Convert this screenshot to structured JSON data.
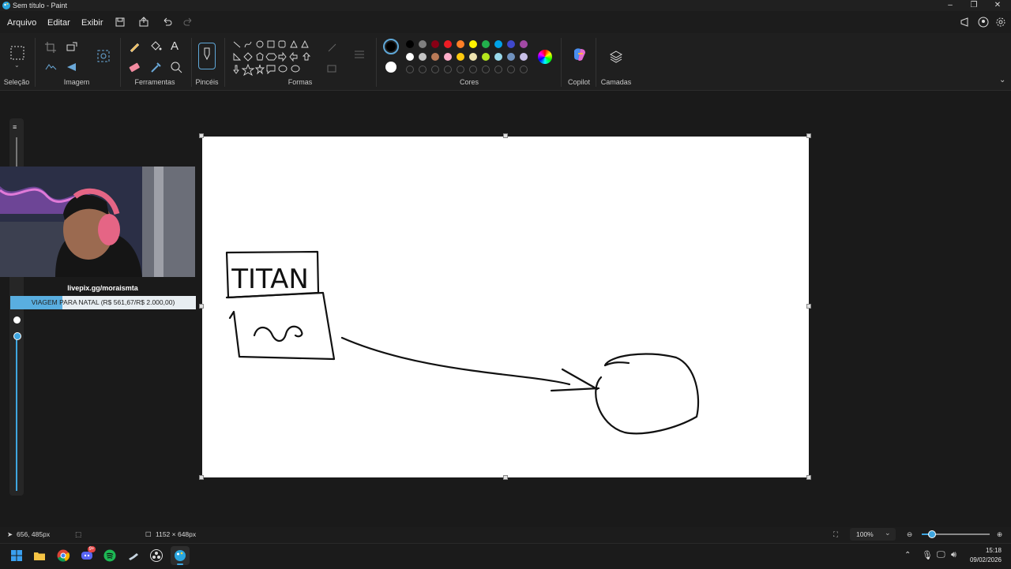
{
  "window": {
    "title": "Sem título - Paint"
  },
  "menu": {
    "items": [
      "Arquivo",
      "Editar",
      "Exibir"
    ]
  },
  "ribbon": {
    "groups": [
      "Seleção",
      "Imagem",
      "Ferramentas",
      "Pincéis",
      "Formas",
      "Cores",
      "Copilot",
      "Camadas"
    ]
  },
  "colors": {
    "primary": "#000000",
    "secondary": "#ffffff",
    "palette_row1": [
      "#000000",
      "#7f7f7f",
      "#880015",
      "#ed1c24",
      "#ff7f27",
      "#fff200",
      "#22b14c",
      "#00a2e8",
      "#3f48cc",
      "#a349a4"
    ],
    "palette_row2": [
      "#ffffff",
      "#c3c3c3",
      "#b97a57",
      "#ffaec9",
      "#ffc90e",
      "#efe4b0",
      "#b5e61d",
      "#99d9ea",
      "#7092be",
      "#c8bfe7"
    ]
  },
  "overlay": {
    "url": "livepix.gg/moraismta",
    "goal_text": "VIAGEM PARA NATAL (R$ 561,67/R$ 2.000,00)",
    "goal_progress": 0.28
  },
  "drawing": {
    "box_text": "TITAN"
  },
  "status": {
    "cursor_pos": "656, 485px",
    "canvas_size": "1152 × 648px",
    "zoom": "100%"
  },
  "taskbar": {
    "time": "15:18",
    "date": "09/02/2026",
    "badge": "9+"
  }
}
